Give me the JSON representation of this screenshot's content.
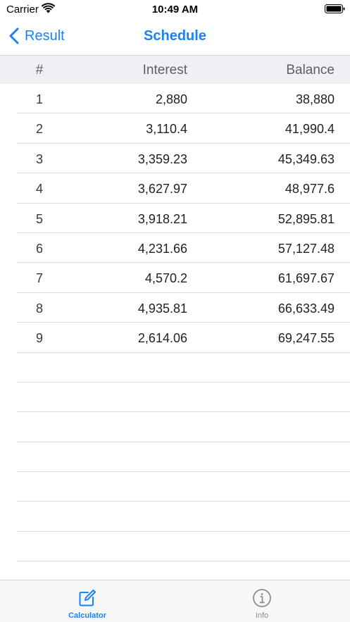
{
  "status_bar": {
    "carrier": "Carrier",
    "time": "10:49 AM",
    "wifi_icon": "wifi-icon",
    "battery_icon": "battery-icon"
  },
  "nav": {
    "back_label": "Result",
    "title": "Schedule",
    "accent_color": "#1a82f5"
  },
  "table": {
    "headers": {
      "num": "#",
      "interest": "Interest",
      "balance": "Balance"
    },
    "rows": [
      {
        "num": "1",
        "interest": "2,880",
        "balance": "38,880"
      },
      {
        "num": "2",
        "interest": "3,110.4",
        "balance": "41,990.4"
      },
      {
        "num": "3",
        "interest": "3,359.23",
        "balance": "45,349.63"
      },
      {
        "num": "4",
        "interest": "3,627.97",
        "balance": "48,977.6"
      },
      {
        "num": "5",
        "interest": "3,918.21",
        "balance": "52,895.81"
      },
      {
        "num": "6",
        "interest": "4,231.66",
        "balance": "57,127.48"
      },
      {
        "num": "7",
        "interest": "4,570.2",
        "balance": "61,697.67"
      },
      {
        "num": "8",
        "interest": "4,935.81",
        "balance": "66,633.49"
      },
      {
        "num": "9",
        "interest": "2,614.06",
        "balance": "69,247.55"
      },
      {
        "num": "",
        "interest": "",
        "balance": ""
      },
      {
        "num": "",
        "interest": "",
        "balance": ""
      },
      {
        "num": "",
        "interest": "",
        "balance": ""
      },
      {
        "num": "",
        "interest": "",
        "balance": ""
      },
      {
        "num": "",
        "interest": "",
        "balance": ""
      },
      {
        "num": "",
        "interest": "",
        "balance": ""
      },
      {
        "num": "",
        "interest": "",
        "balance": ""
      },
      {
        "num": "",
        "interest": "",
        "balance": ""
      }
    ]
  },
  "tab_bar": {
    "tabs": [
      {
        "label": "Calculator",
        "icon": "edit-icon",
        "selected": true
      },
      {
        "label": "Info",
        "icon": "info-icon",
        "selected": false
      }
    ]
  }
}
